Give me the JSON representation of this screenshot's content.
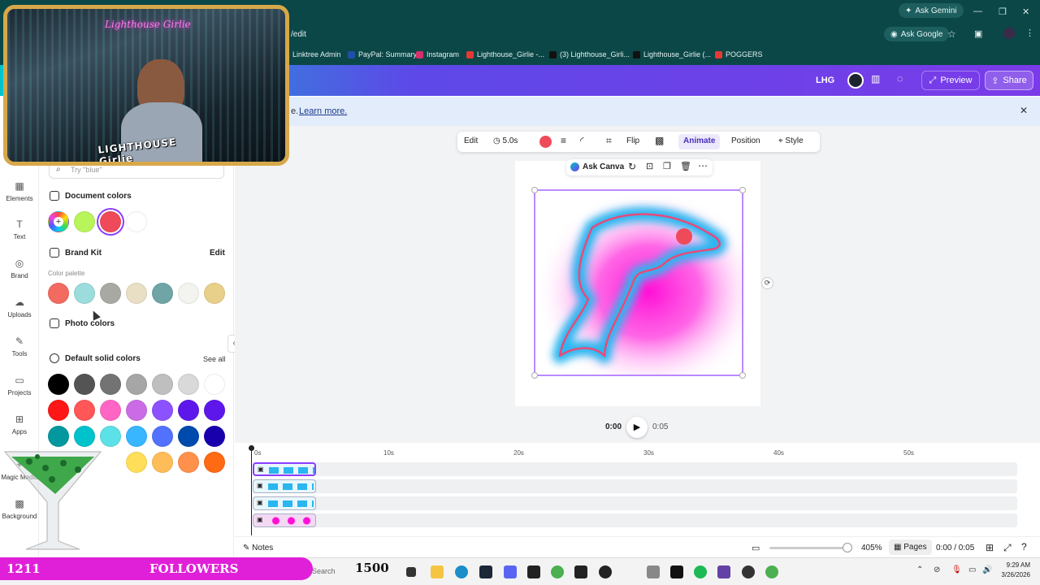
{
  "browser": {
    "tab_fragment": "/edit",
    "ask_gemini": "Ask Gemini",
    "ask_google": "Ask Google",
    "bookmarks": [
      {
        "label": "Linktree Admin",
        "color": "#2ecc71"
      },
      {
        "label": "PayPal: Summary",
        "color": "#1f4fa8"
      },
      {
        "label": "Instagram",
        "color": "#d6306b"
      },
      {
        "label": "Lighthouse_Girlie -...",
        "color": "#e53935"
      },
      {
        "label": "(3) Lighthouse_Girli...",
        "color": "#111111"
      },
      {
        "label": "Lighthouse_Girlie (...",
        "color": "#111111"
      },
      {
        "label": "POGGERS",
        "color": "#e53935"
      }
    ]
  },
  "canva_header": {
    "team_initials": "LHG",
    "preview_label": "Preview",
    "share_label": "Share"
  },
  "banner": {
    "text_fragment": "e.",
    "link_label": "Learn more."
  },
  "rail": [
    {
      "label": "Elements",
      "icon": "elements-icon",
      "glyph": "▦"
    },
    {
      "label": "Text",
      "icon": "text-icon",
      "glyph": "T"
    },
    {
      "label": "Brand",
      "icon": "brand-icon",
      "glyph": "◎"
    },
    {
      "label": "Uploads",
      "icon": "upload-icon",
      "glyph": "☁"
    },
    {
      "label": "Tools",
      "icon": "tools-icon",
      "glyph": "✎"
    },
    {
      "label": "Projects",
      "icon": "folder-icon",
      "glyph": "▭"
    },
    {
      "label": "Apps",
      "icon": "apps-icon",
      "glyph": "⊞"
    },
    {
      "label": "Magic Media",
      "icon": "magic-media-icon",
      "glyph": "✦"
    },
    {
      "label": "Background",
      "icon": "background-icon",
      "glyph": "▩"
    }
  ],
  "panel": {
    "search_placeholder": "Try \"blue\"",
    "document_colors_title": "Document colors",
    "document_colors": [
      "#b8f55a",
      "#ef4a5a",
      "#ffffff"
    ],
    "brand_kit_title": "Brand Kit",
    "brand_kit_edit": "Edit",
    "palette_label": "Color palette",
    "palette": [
      "#f26a60",
      "#9ddcdc",
      "#a9a9a4",
      "#e8dfc4",
      "#6fa5a6",
      "#f3f3ef",
      "#e9d08a"
    ],
    "photo_colors_title": "Photo colors",
    "default_title": "Default solid colors",
    "see_all": "See all",
    "default_rows": [
      [
        "#000000",
        "#545454",
        "#737373",
        "#a6a6a6",
        "#bfbfbf",
        "#d9d9d9",
        "#ffffff"
      ],
      [
        "#ff1616",
        "#ff5757",
        "#ff66c4",
        "#cb6ce6",
        "#8c52ff",
        "#5e17eb",
        "#5e17eb"
      ],
      [
        "#03989e",
        "#00c2cb",
        "#5ce1e6",
        "#38b6ff",
        "#5271ff",
        "#004aad",
        "#1800ad"
      ],
      [
        "#00bf63",
        "#7ed957",
        "#c1ff72",
        "#ffde59",
        "#ffbd59",
        "#ff914d",
        "#ff6a13"
      ]
    ]
  },
  "toolbar": {
    "edit": "Edit",
    "duration": "5.0s",
    "fill_color": "#ef4a5a",
    "flip": "Flip",
    "animate": "Animate",
    "position": "Position",
    "style": "Style"
  },
  "element_toolbar": {
    "ask_canva": "Ask Canva"
  },
  "playback": {
    "current": "0:00",
    "total": "0:05"
  },
  "timeline": {
    "ticks": [
      "0s",
      "10s",
      "20s",
      "30s",
      "40s",
      "50s"
    ]
  },
  "statusbar": {
    "notes": "Notes",
    "zoom": "405%",
    "pages": "Pages",
    "time": "0:00 / 0:05"
  },
  "taskbar": {
    "search_placeholder": "Search",
    "clock_time": "9:29 AM",
    "clock_date": "3/26/2026"
  },
  "overlay": {
    "channel_name": "Lighthouse Girlie",
    "logo_text": "LIGHTHOUSE Girlie",
    "followers_count": "1211",
    "followers_label": "FOLLOWERS",
    "followers_goal": "1500"
  }
}
